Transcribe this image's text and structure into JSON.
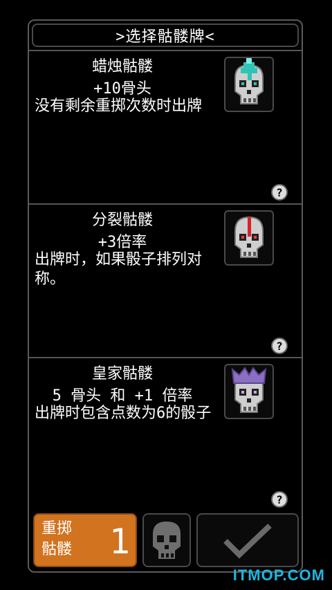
{
  "title": ">选择骷髅牌<",
  "cards": [
    {
      "name": "蜡烛骷髅",
      "effect": "+10骨头",
      "desc": "没有剩余重掷次数时出牌",
      "portrait_icon": "candle-skull-icon",
      "help": "?"
    },
    {
      "name": "分裂骷髅",
      "effect": "+3倍率",
      "desc": "出牌时，如果骰子排列对称。",
      "portrait_icon": "split-skull-icon",
      "help": "?"
    },
    {
      "name": "皇家骷髅",
      "effect": "5 骨头 和 +1 倍率",
      "desc": "出牌时包含点数为6的骰子",
      "portrait_icon": "royal-skull-icon",
      "help": "?"
    }
  ],
  "bottom": {
    "reroll_label_line1": "重掷",
    "reroll_label_line2": "骷髅",
    "reroll_count": "1"
  },
  "watermark": "ITMOP.COM",
  "colors": {
    "accent": "#d2731f",
    "candle": "#2ec4b6",
    "split": "#d8212a",
    "crown": "#8a6fc2",
    "watermark": "#1fb6e0"
  }
}
